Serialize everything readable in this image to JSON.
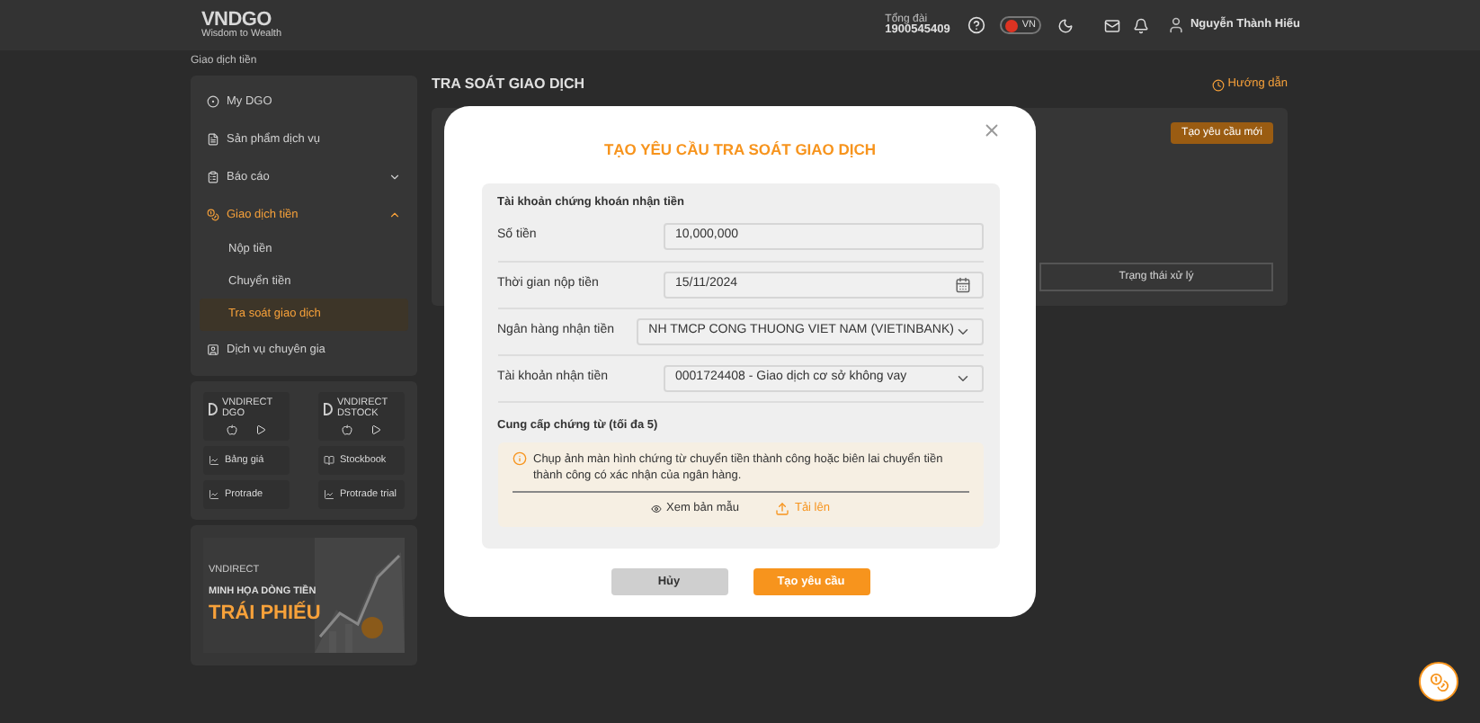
{
  "header": {
    "logo": "VNDGO",
    "tagline": "Wisdom to Wealth",
    "hotline_label": "Tổng đài",
    "hotline": "1900545409",
    "language": "VN",
    "user_name": "Nguyễn Thành Hiếu"
  },
  "breadcrumb": "Giao dịch tiền",
  "sidebar": {
    "items": [
      {
        "label": "My DGO",
        "selected": false
      },
      {
        "label": "Sản phẩm dịch vụ",
        "selected": false
      },
      {
        "label": "Báo cáo",
        "selected": false,
        "expanded": false
      },
      {
        "label": "Giao dịch tiền",
        "selected": true,
        "expanded": true,
        "children": [
          {
            "label": "Nộp tiền",
            "selected": false
          },
          {
            "label": "Chuyển tiền",
            "selected": false
          },
          {
            "label": "Tra soát giao dịch",
            "selected": true
          }
        ]
      },
      {
        "label": "Dịch vụ chuyên gia",
        "selected": false
      }
    ],
    "apps": [
      {
        "name": "VNDIRECT DGO"
      },
      {
        "name": "VNDIRECT DSTOCK"
      }
    ],
    "links": [
      "Bảng giá",
      "Stockbook",
      "Protrade",
      "Protrade trial"
    ],
    "banner": {
      "brand": "VNDIRECT",
      "line_1": "MINH HỌA DÒNG TIỀN",
      "line_2": "TRÁI PHIẾU"
    }
  },
  "page": {
    "title": "TRA SOÁT GIAO DỊCH",
    "guide_link": "Hướng dẫn",
    "new_request_button": "Tạo yêu cầu mới",
    "table_header": "Trạng thái xử lý"
  },
  "modal": {
    "title": "TẠO YÊU CẦU TRA SOÁT GIAO DỊCH",
    "section_title": "Tài khoản chứng khoán nhận tiền",
    "fields": [
      {
        "kind": "text",
        "label": "Số tiền",
        "value": "10,000,000"
      },
      {
        "kind": "date",
        "label": "Thời gian nộp tiền",
        "value": "15/11/2024"
      },
      {
        "kind": "select",
        "label": "Ngân hàng nhận tiền",
        "value": "NH TMCP CONG THUONG VIET NAM (VIETINBANK)"
      },
      {
        "kind": "select",
        "label": "Tài khoản nhận tiền",
        "value": "0001724408 - Giao dịch cơ sở không vay"
      }
    ],
    "documents_title": "Cung cấp chứng từ (tối đa 5)",
    "notice": "Chụp ảnh màn hình chứng từ chuyển tiền thành công hoặc biên lai chuyển tiền thành công có xác nhận của ngân hàng.",
    "view_sample": "Xem bản mẫu",
    "upload": "Tải lên",
    "cancel_button": "Hủy",
    "submit_button": "Tạo yêu cầu"
  }
}
